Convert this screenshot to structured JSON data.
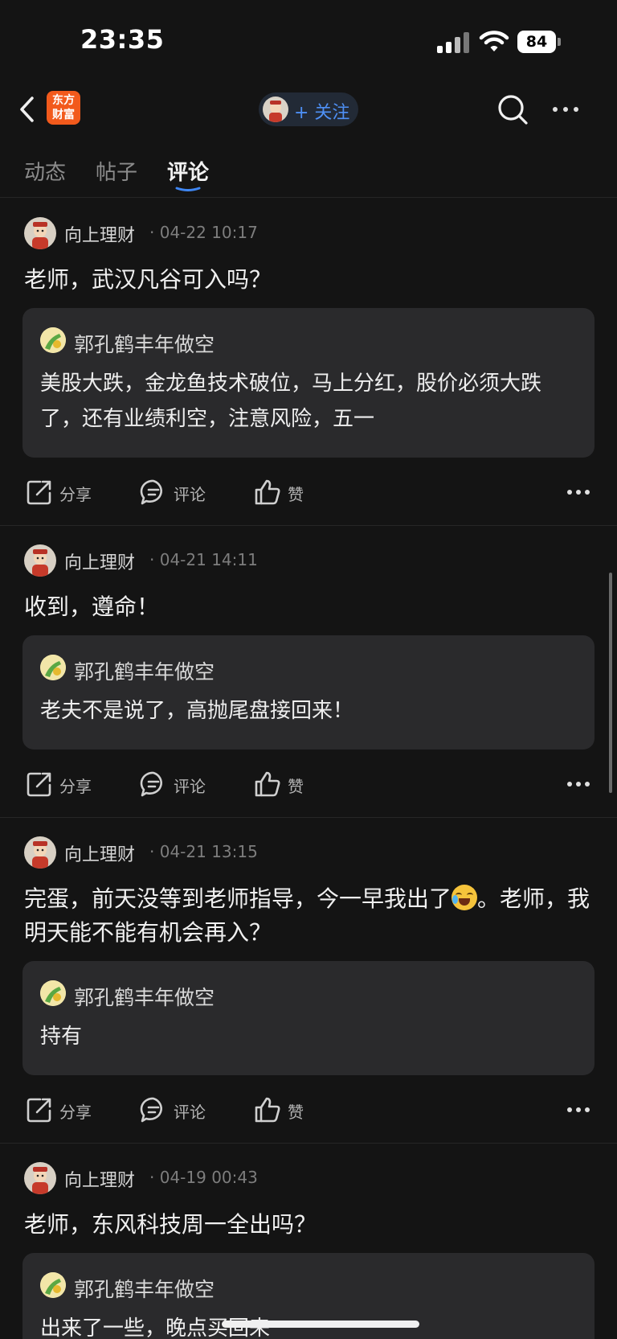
{
  "status_bar": {
    "time": "23:35",
    "battery": "84"
  },
  "nav": {
    "logo_line1": "东方",
    "logo_line2": "财富",
    "follow_label": "+ 关注"
  },
  "tabs": [
    {
      "label": "动态",
      "active": false
    },
    {
      "label": "帖子",
      "active": false
    },
    {
      "label": "评论",
      "active": true
    }
  ],
  "actions": {
    "share": "分享",
    "comment": "评论",
    "like": "赞"
  },
  "posts": [
    {
      "author": "向上理财",
      "time": "· 04-22 10:17",
      "content": "老师，武汉凡谷可入吗？",
      "quote": {
        "author": "郭孔鹤丰年做空",
        "text": "美股大跌，金龙鱼技术破位，马上分红，股价必须大跌了，还有业绩利空，注意风险，五一"
      }
    },
    {
      "author": "向上理财",
      "time": "· 04-21 14:11",
      "content": "收到，遵命！",
      "quote": {
        "author": "郭孔鹤丰年做空",
        "text": "老夫不是说了，高抛尾盘接回来！"
      }
    },
    {
      "author": "向上理财",
      "time": "· 04-21 13:15",
      "content_before": "完蛋，前天没等到老师指导，今一早我出了",
      "content_after": "。老师，我明天能不能有机会再入？",
      "quote": {
        "author": "郭孔鹤丰年做空",
        "text": "持有"
      }
    },
    {
      "author": "向上理财",
      "time": "· 04-19 00:43",
      "content": "老师，东风科技周一全出吗？",
      "quote": {
        "author": "郭孔鹤丰年做空",
        "text": "出来了一些，晚点买回来"
      }
    }
  ]
}
